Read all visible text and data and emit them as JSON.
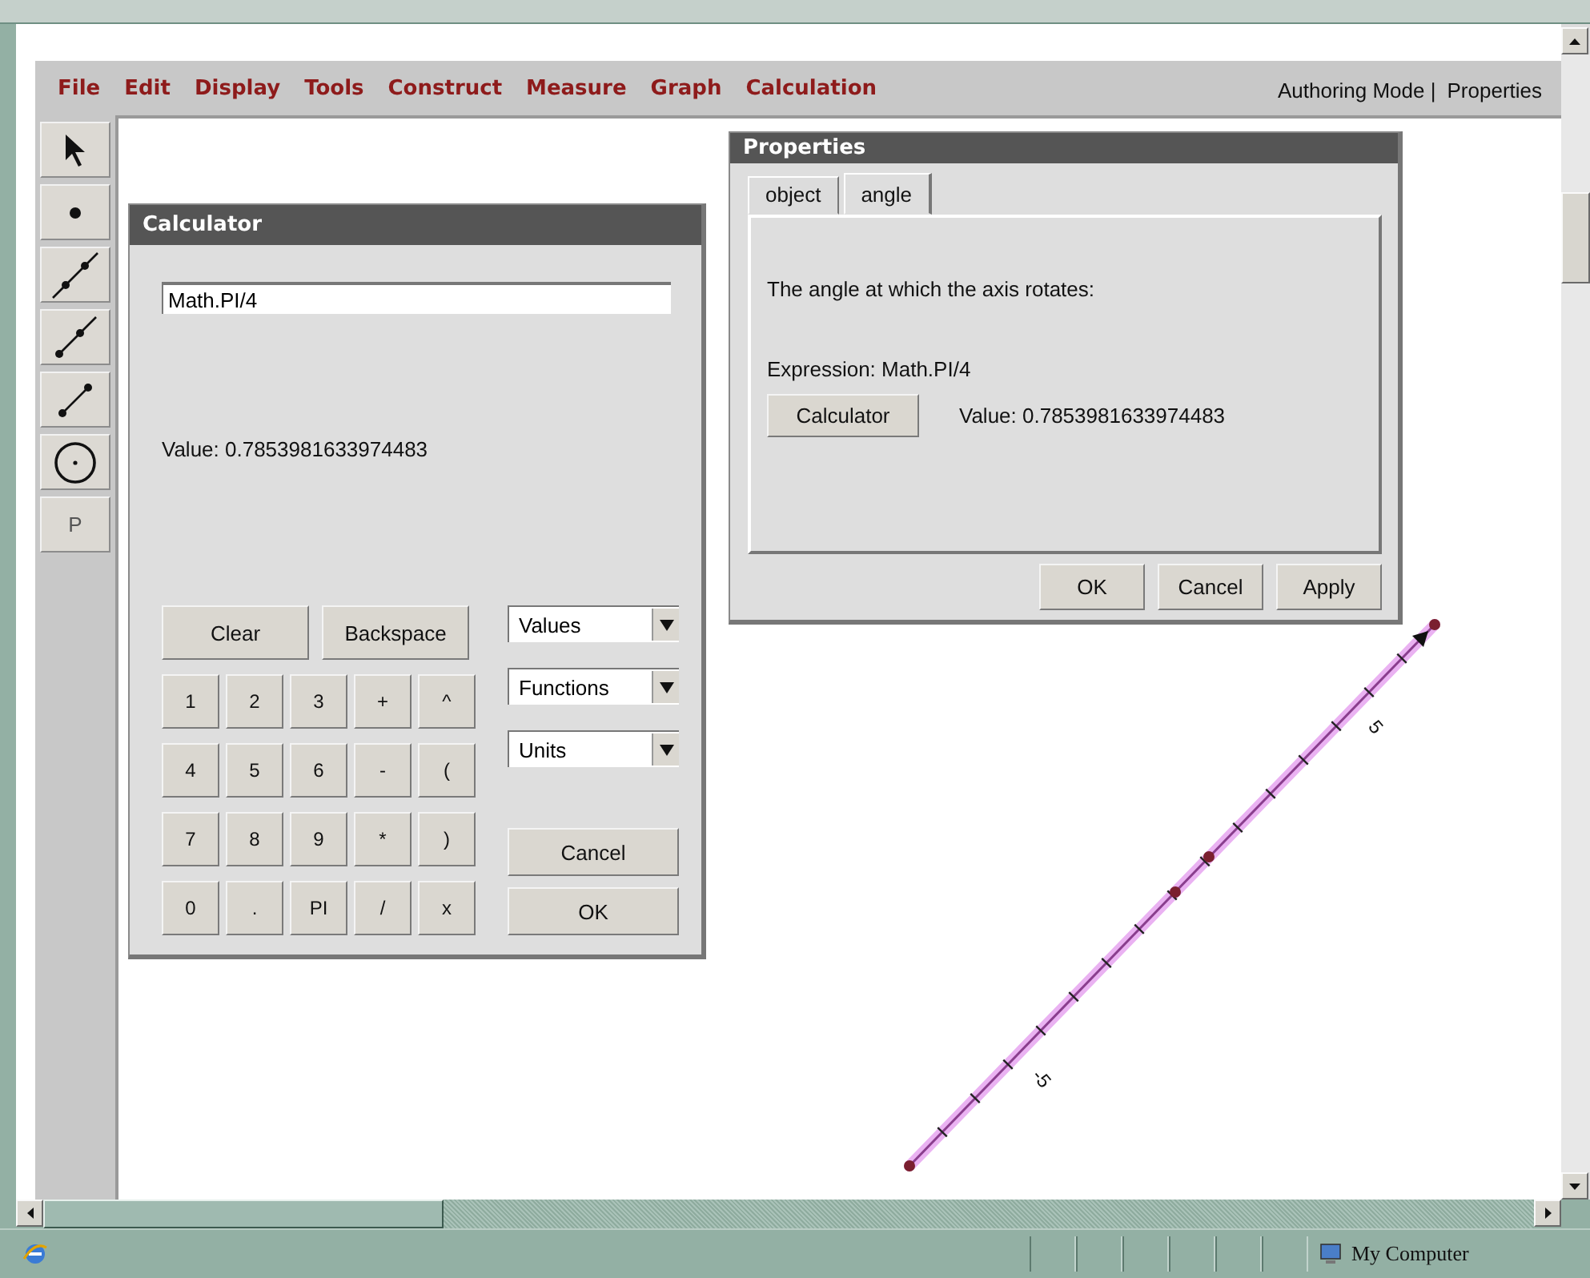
{
  "menu": [
    "File",
    "Edit",
    "Display",
    "Tools",
    "Construct",
    "Measure",
    "Graph",
    "Calculation"
  ],
  "mode_links": [
    "Authoring Mode |",
    "Properties"
  ],
  "tools": [
    {
      "kind": "arrow"
    },
    {
      "kind": "point"
    },
    {
      "kind": "line"
    },
    {
      "kind": "ray"
    },
    {
      "kind": "segment"
    },
    {
      "kind": "circle"
    },
    {
      "kind": "text",
      "label": "P"
    }
  ],
  "calculator": {
    "title": "Calculator",
    "expression": "Math.PI/4",
    "value": "Value: 0.7853981633974483",
    "actions": [
      "Clear",
      "Backspace"
    ],
    "keys": [
      [
        "1",
        "2",
        "3",
        "+",
        "^"
      ],
      [
        "4",
        "5",
        "6",
        "-",
        "("
      ],
      [
        "7",
        "8",
        "9",
        "*",
        ")"
      ],
      [
        "0",
        ".",
        "PI",
        "/",
        "x"
      ]
    ],
    "dropdowns": [
      "Values",
      "Functions",
      "Units"
    ],
    "buttons": [
      "Cancel",
      "OK"
    ]
  },
  "properties": {
    "title": "Properties",
    "tabs": [
      {
        "label": "object",
        "selected": false
      },
      {
        "label": "angle",
        "selected": true
      }
    ],
    "description": "The angle at which the axis rotates:",
    "expression": "Expression: Math.PI/4",
    "calculator_button": "Calculator",
    "value": "Value: 0.7853981633974483",
    "buttons": [
      "OK",
      "Cancel",
      "Apply"
    ]
  },
  "axis": {
    "tick_labels": [
      "5",
      "-5"
    ]
  },
  "status_bar": {
    "zone": "My Computer"
  }
}
